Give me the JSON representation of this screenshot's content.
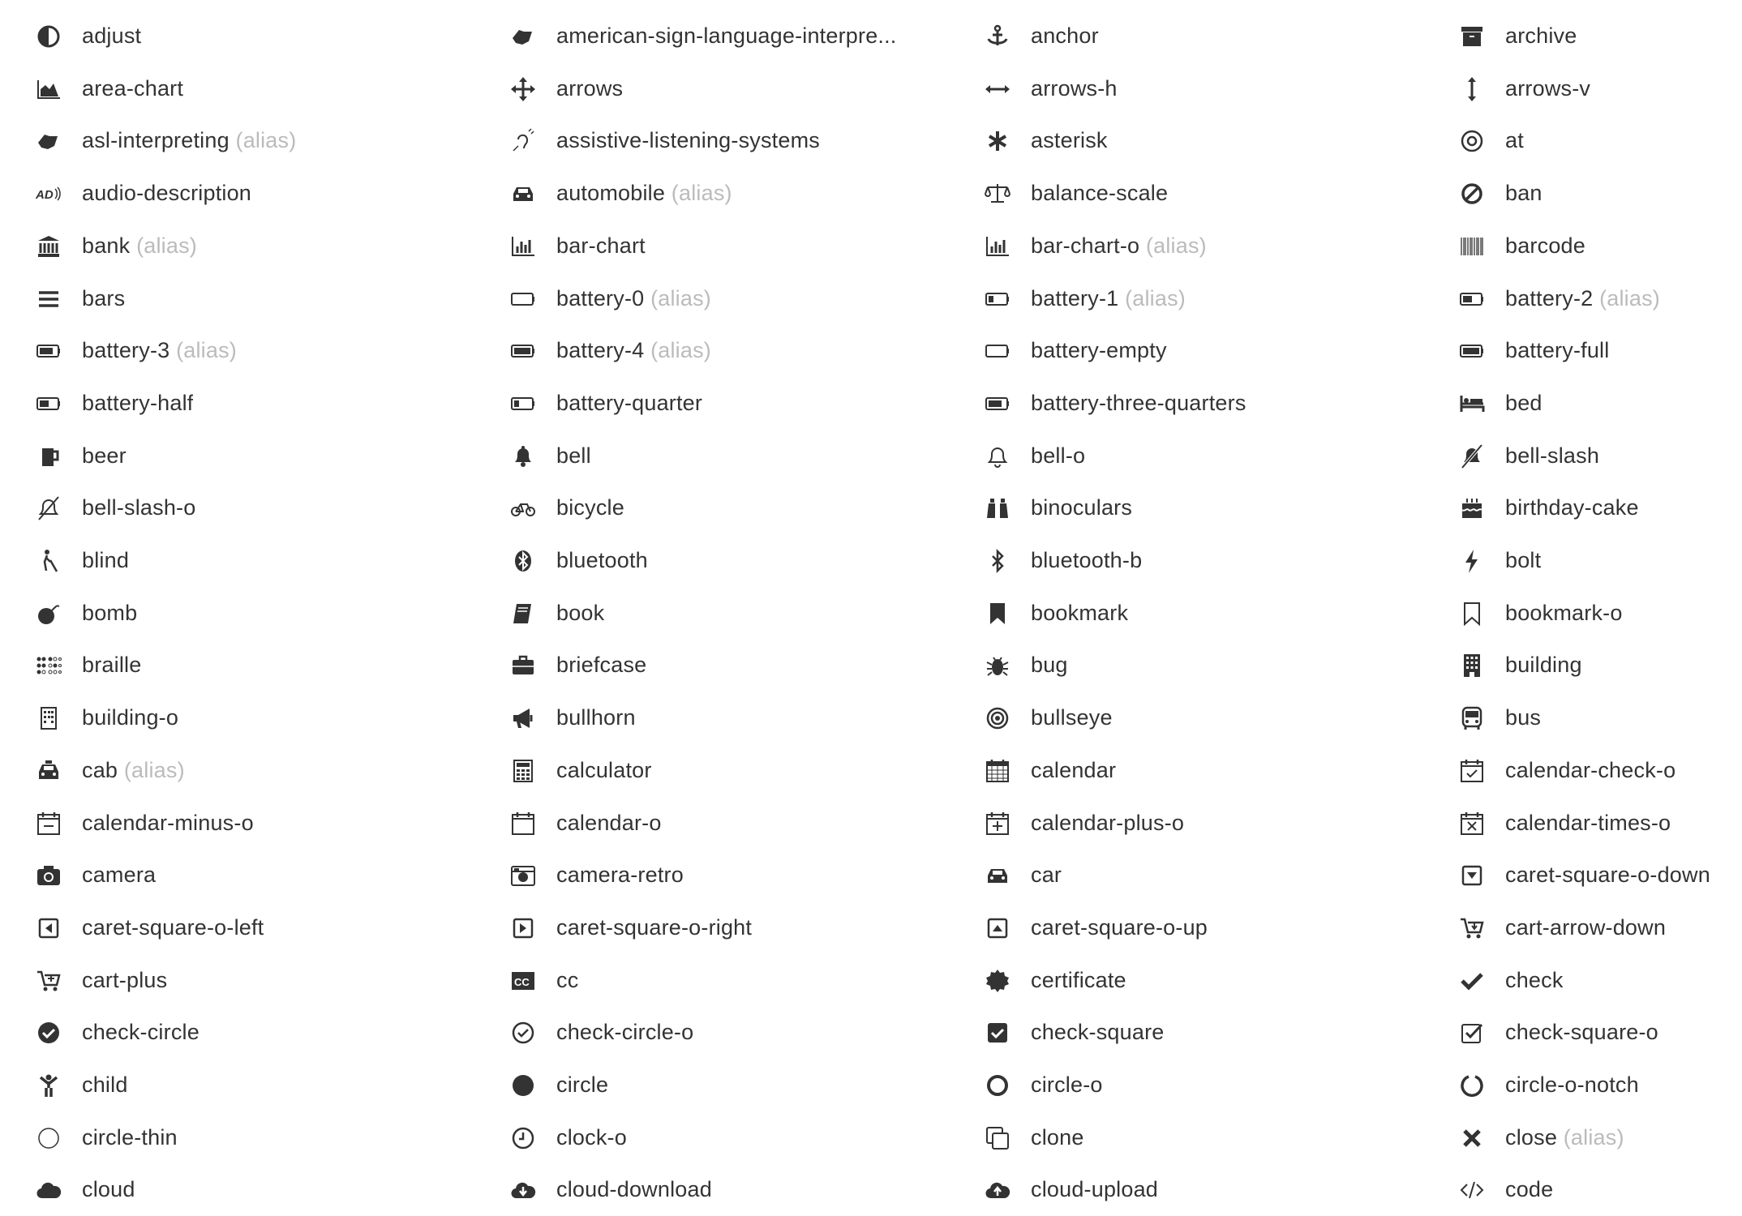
{
  "alias_label": "(alias)",
  "icons": [
    {
      "name": "adjust",
      "icon": "adjust-icon"
    },
    {
      "name": "american-sign-language-interpreting",
      "display": "american-sign-language-interpre...",
      "icon": "american-sign-language-interpreting-icon"
    },
    {
      "name": "anchor",
      "icon": "anchor-icon"
    },
    {
      "name": "archive",
      "icon": "archive-icon"
    },
    {
      "name": "area-chart",
      "icon": "area-chart-icon"
    },
    {
      "name": "arrows",
      "icon": "arrows-icon"
    },
    {
      "name": "arrows-h",
      "icon": "arrows-h-icon"
    },
    {
      "name": "arrows-v",
      "icon": "arrows-v-icon"
    },
    {
      "name": "asl-interpreting",
      "alias": true,
      "icon": "asl-interpreting-icon"
    },
    {
      "name": "assistive-listening-systems",
      "icon": "assistive-listening-systems-icon"
    },
    {
      "name": "asterisk",
      "icon": "asterisk-icon"
    },
    {
      "name": "at",
      "icon": "at-icon"
    },
    {
      "name": "audio-description",
      "icon": "audio-description-icon"
    },
    {
      "name": "automobile",
      "alias": true,
      "icon": "automobile-icon"
    },
    {
      "name": "balance-scale",
      "icon": "balance-scale-icon"
    },
    {
      "name": "ban",
      "icon": "ban-icon"
    },
    {
      "name": "bank",
      "alias": true,
      "icon": "bank-icon"
    },
    {
      "name": "bar-chart",
      "icon": "bar-chart-icon"
    },
    {
      "name": "bar-chart-o",
      "alias": true,
      "icon": "bar-chart-o-icon"
    },
    {
      "name": "barcode",
      "icon": "barcode-icon"
    },
    {
      "name": "bars",
      "icon": "bars-icon"
    },
    {
      "name": "battery-0",
      "alias": true,
      "icon": "battery-0-icon"
    },
    {
      "name": "battery-1",
      "alias": true,
      "icon": "battery-1-icon"
    },
    {
      "name": "battery-2",
      "alias": true,
      "icon": "battery-2-icon"
    },
    {
      "name": "battery-3",
      "alias": true,
      "icon": "battery-3-icon"
    },
    {
      "name": "battery-4",
      "alias": true,
      "icon": "battery-4-icon"
    },
    {
      "name": "battery-empty",
      "icon": "battery-empty-icon"
    },
    {
      "name": "battery-full",
      "icon": "battery-full-icon"
    },
    {
      "name": "battery-half",
      "icon": "battery-half-icon"
    },
    {
      "name": "battery-quarter",
      "icon": "battery-quarter-icon"
    },
    {
      "name": "battery-three-quarters",
      "icon": "battery-three-quarters-icon"
    },
    {
      "name": "bed",
      "icon": "bed-icon"
    },
    {
      "name": "beer",
      "icon": "beer-icon"
    },
    {
      "name": "bell",
      "icon": "bell-icon"
    },
    {
      "name": "bell-o",
      "icon": "bell-o-icon"
    },
    {
      "name": "bell-slash",
      "icon": "bell-slash-icon"
    },
    {
      "name": "bell-slash-o",
      "icon": "bell-slash-o-icon"
    },
    {
      "name": "bicycle",
      "icon": "bicycle-icon"
    },
    {
      "name": "binoculars",
      "icon": "binoculars-icon"
    },
    {
      "name": "birthday-cake",
      "icon": "birthday-cake-icon"
    },
    {
      "name": "blind",
      "icon": "blind-icon"
    },
    {
      "name": "bluetooth",
      "icon": "bluetooth-icon"
    },
    {
      "name": "bluetooth-b",
      "icon": "bluetooth-b-icon"
    },
    {
      "name": "bolt",
      "icon": "bolt-icon"
    },
    {
      "name": "bomb",
      "icon": "bomb-icon"
    },
    {
      "name": "book",
      "icon": "book-icon"
    },
    {
      "name": "bookmark",
      "icon": "bookmark-icon"
    },
    {
      "name": "bookmark-o",
      "icon": "bookmark-o-icon"
    },
    {
      "name": "braille",
      "icon": "braille-icon"
    },
    {
      "name": "briefcase",
      "icon": "briefcase-icon"
    },
    {
      "name": "bug",
      "icon": "bug-icon"
    },
    {
      "name": "building",
      "icon": "building-icon"
    },
    {
      "name": "building-o",
      "icon": "building-o-icon"
    },
    {
      "name": "bullhorn",
      "icon": "bullhorn-icon"
    },
    {
      "name": "bullseye",
      "icon": "bullseye-icon"
    },
    {
      "name": "bus",
      "icon": "bus-icon"
    },
    {
      "name": "cab",
      "alias": true,
      "icon": "cab-icon"
    },
    {
      "name": "calculator",
      "icon": "calculator-icon"
    },
    {
      "name": "calendar",
      "icon": "calendar-icon"
    },
    {
      "name": "calendar-check-o",
      "icon": "calendar-check-o-icon"
    },
    {
      "name": "calendar-minus-o",
      "icon": "calendar-minus-o-icon"
    },
    {
      "name": "calendar-o",
      "icon": "calendar-o-icon"
    },
    {
      "name": "calendar-plus-o",
      "icon": "calendar-plus-o-icon"
    },
    {
      "name": "calendar-times-o",
      "icon": "calendar-times-o-icon"
    },
    {
      "name": "camera",
      "icon": "camera-icon"
    },
    {
      "name": "camera-retro",
      "icon": "camera-retro-icon"
    },
    {
      "name": "car",
      "icon": "car-icon"
    },
    {
      "name": "caret-square-o-down",
      "icon": "caret-square-o-down-icon"
    },
    {
      "name": "caret-square-o-left",
      "icon": "caret-square-o-left-icon"
    },
    {
      "name": "caret-square-o-right",
      "icon": "caret-square-o-right-icon"
    },
    {
      "name": "caret-square-o-up",
      "icon": "caret-square-o-up-icon"
    },
    {
      "name": "cart-arrow-down",
      "icon": "cart-arrow-down-icon"
    },
    {
      "name": "cart-plus",
      "icon": "cart-plus-icon"
    },
    {
      "name": "cc",
      "icon": "cc-icon"
    },
    {
      "name": "certificate",
      "icon": "certificate-icon"
    },
    {
      "name": "check",
      "icon": "check-icon"
    },
    {
      "name": "check-circle",
      "icon": "check-circle-icon"
    },
    {
      "name": "check-circle-o",
      "icon": "check-circle-o-icon"
    },
    {
      "name": "check-square",
      "icon": "check-square-icon"
    },
    {
      "name": "check-square-o",
      "icon": "check-square-o-icon"
    },
    {
      "name": "child",
      "icon": "child-icon"
    },
    {
      "name": "circle",
      "icon": "circle-icon"
    },
    {
      "name": "circle-o",
      "icon": "circle-o-icon"
    },
    {
      "name": "circle-o-notch",
      "icon": "circle-o-notch-icon"
    },
    {
      "name": "circle-thin",
      "icon": "circle-thin-icon"
    },
    {
      "name": "clock-o",
      "icon": "clock-o-icon"
    },
    {
      "name": "clone",
      "icon": "clone-icon"
    },
    {
      "name": "close",
      "alias": true,
      "icon": "close-icon"
    },
    {
      "name": "cloud",
      "icon": "cloud-icon"
    },
    {
      "name": "cloud-download",
      "icon": "cloud-download-icon"
    },
    {
      "name": "cloud-upload",
      "icon": "cloud-upload-icon"
    },
    {
      "name": "code",
      "icon": "code-icon"
    }
  ]
}
